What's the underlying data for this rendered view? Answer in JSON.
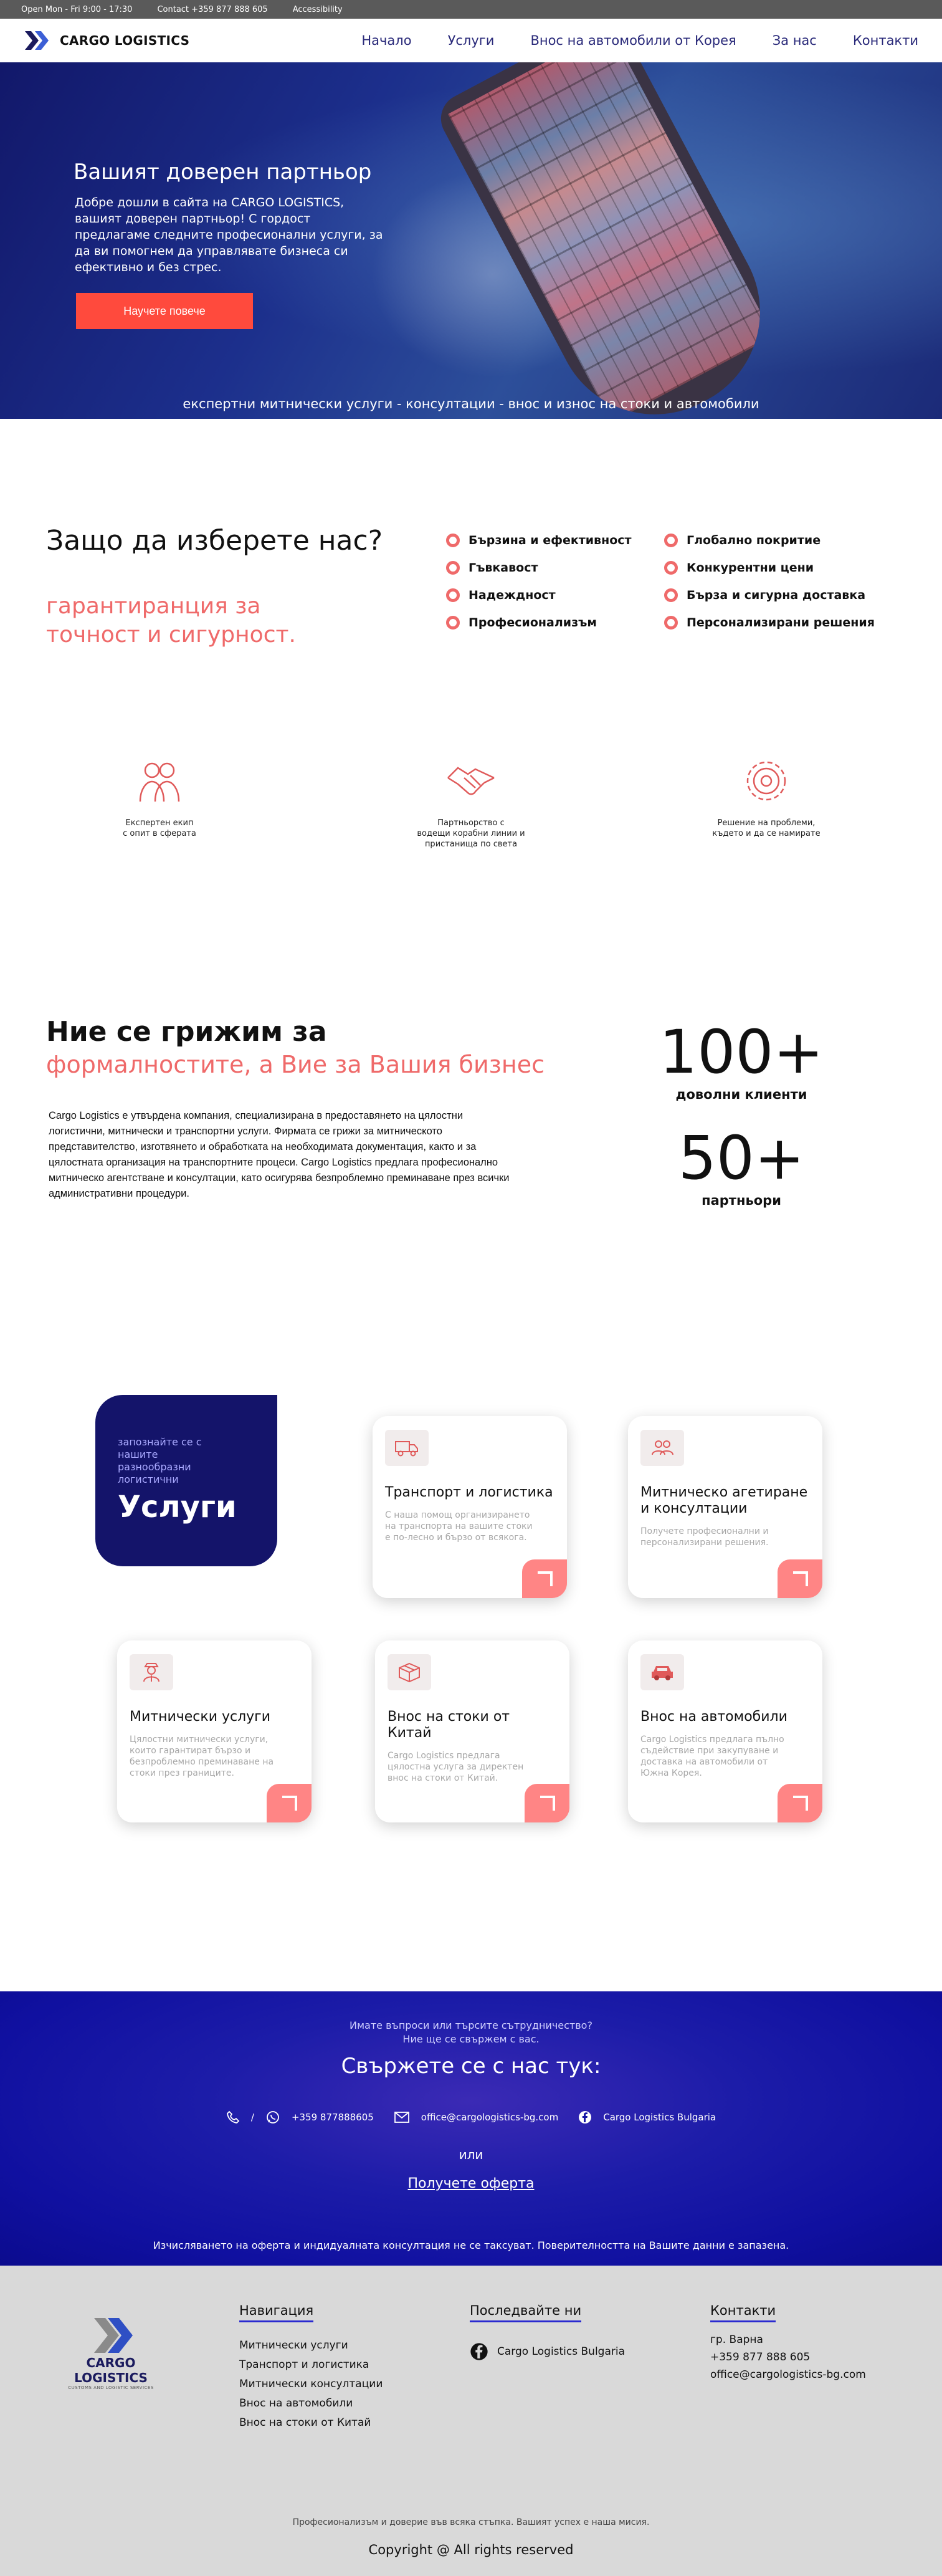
{
  "topbar": {
    "hours": "Open Mon - Fri 9:00 - 17:30",
    "contact": "Contact +359 877 888 605",
    "accessibility": "Accessibility"
  },
  "header": {
    "logo_text": "CARGO LOGISTICS",
    "nav": [
      "Начало",
      "Услуги",
      "Внос на автомобили от Корея",
      "За нас",
      "Контакти"
    ]
  },
  "hero": {
    "title": "Вашият доверен партньор",
    "text": "Добре дошли в сайта на CARGO LOGISTICS, вашият доверен партньор! С гордост предлагаме следните професионални услуги, за да ви помогнем да управлявате бизнеса си ефективно и без стрес.",
    "button": "Научете повече",
    "tagline": "експертни митнически услуги - консултации - внос и износ на стоки и автомобили"
  },
  "why": {
    "title": "Защо да изберете нас?",
    "subtitle": "гарантиранция за точност и сигурност.",
    "features": [
      "Бързина и ефективност",
      "Глобално покритие",
      "Гъвкавост",
      "Конкурентни цени",
      "Надеждност",
      "Бърза и сигурна доставка",
      "Професионализъм",
      "Персонализирани решения"
    ]
  },
  "highlights": [
    {
      "icon": "team-icon",
      "caption_l1": "Експертен екип",
      "caption_l2": "с опит в сферата",
      "caption_l3": ""
    },
    {
      "icon": "handshake-icon",
      "caption_l1": "Партньорство с",
      "caption_l2": "водещи корабни линии и",
      "caption_l3": "пристанища по света"
    },
    {
      "icon": "gear-solution-icon",
      "caption_l1": "Решение на проблеми,",
      "caption_l2": "където и да се намирате",
      "caption_l3": ""
    }
  ],
  "about": {
    "title": "Ние се грижим за",
    "subtitle": "формалностите, а Вие за Вашия бизнес",
    "text": "Cargo Logistics е утвърдена компания, специализирана в предоставянето на цялостни логистични, митнически и транспортни услуги. Фирмата се грижи за митническото представителство, изготвянето и обработката на необходимата документация, както и за цялостната организация на транспортните процеси. Cargo Logistics предлага професионално митническо агентстване и консултации, като осигурява безпроблемно преминаване през всички административни процедури.",
    "stats": [
      {
        "number": "100+",
        "label": "доволни клиенти"
      },
      {
        "number": "50+",
        "label": "партньори"
      }
    ]
  },
  "services": {
    "intro_small": "запознайте се с нашите разнообразни логистични",
    "intro_big": "Услуги",
    "cards": [
      {
        "icon": "truck-icon",
        "title": "Транспорт и логистика",
        "desc": "С наша помощ организирането на транспорта на вашите стоки е по-лесно и бързо от всякога."
      },
      {
        "icon": "consulting-icon",
        "title": "Митническо агетиране и консултации",
        "desc": "Получете професионални и персонализирани решения."
      },
      {
        "icon": "customs-officer-icon",
        "title": "Митнически услуги",
        "desc": "Цялостни митнически услуги, които гарантират бързо и безпроблемно преминаване на стоки през границите."
      },
      {
        "icon": "box-icon",
        "title": "Внос на стоки от Китай",
        "desc": "Cargo Logistics предлага цялостна услуга за директен внос на стоки от Китай."
      },
      {
        "icon": "car-icon",
        "title": "Внос на автомобили",
        "desc": "Cargo Logistics предлага пълно съдействие при закупуване и доставка на автомобили от Южна Корея."
      }
    ]
  },
  "contact": {
    "question_l1": "Имате въпроси или търсите сътрудничество?",
    "question_l2": "Ние ще се свържем с вас.",
    "heading": "Свържете се с нас тук:",
    "phone": "+359 877888605",
    "email": "office@cargologistics-bg.com",
    "facebook": "Cargo Logistics Bulgaria",
    "or": "или",
    "cta": "Получете оферта",
    "note": "Изчисляването на оферта и индидуалната консултация не се таксуват. Поверителността на Вашите данни е запазена."
  },
  "footer": {
    "logo_text": "CARGO LOGISTICS",
    "logo_sub": "CUSTOMS AND LOGISTIC SERVICES",
    "nav_title": "Навигация",
    "nav_items": [
      "Митнически услуги",
      "Транспорт и логистика",
      "Митнически консултации",
      "Внос на автомобили",
      "Внос на стоки от Китай"
    ],
    "follow_title": "Последвайте ни",
    "follow_fb": "Cargo Logistics Bulgaria",
    "contacts_title": "Контакти",
    "contacts": [
      "гр. Варна",
      "+359 877 888 605",
      "office@cargologistics-bg.com"
    ],
    "tagline": "Професионализъм и доверие във всяка стъпка. Вашият успех е наша мисия.",
    "copyright": "Copyright @ All rights reserved"
  },
  "colors": {
    "accent": "#ef6a6a",
    "button": "#ff4a3d",
    "navy": "#14146a",
    "nav_text": "#2a2a7a"
  }
}
